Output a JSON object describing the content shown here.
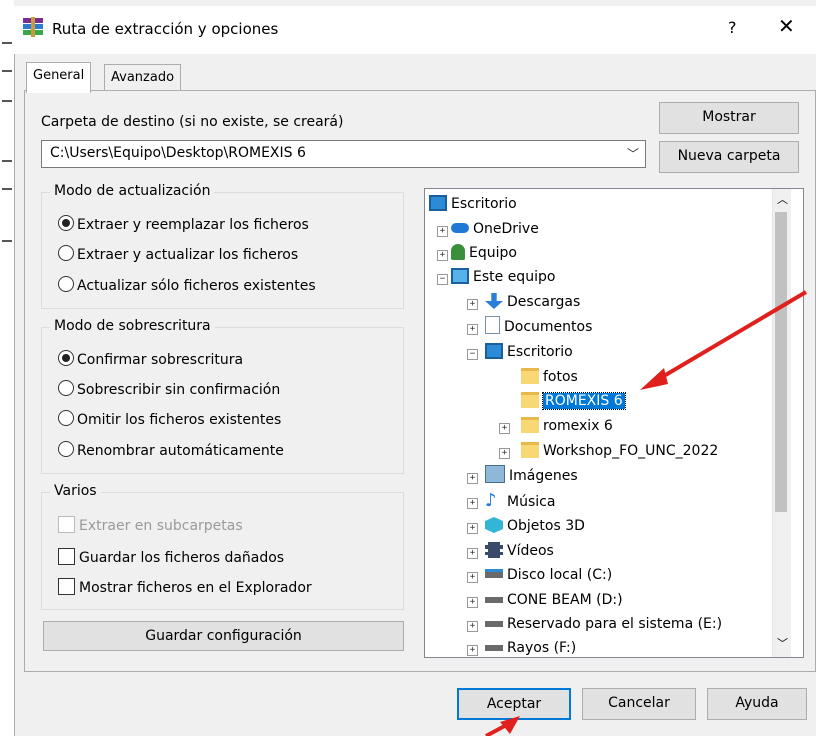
{
  "window": {
    "title": "Ruta de extracción y opciones",
    "help_label": "?",
    "close_label": "✕"
  },
  "tabs": [
    {
      "label": "General"
    },
    {
      "label": "Avanzado"
    }
  ],
  "destination": {
    "label": "Carpeta de destino (si no existe, se creará)",
    "path": "C:\\Users\\Equipo\\Desktop\\ROMEXIS 6",
    "show_button": "Mostrar",
    "new_folder_button": "Nueva carpeta"
  },
  "update_mode": {
    "title": "Modo de actualización",
    "options": [
      "Extraer y reemplazar los ficheros",
      "Extraer y actualizar los ficheros",
      "Actualizar sólo ficheros existentes"
    ],
    "selected": 0
  },
  "overwrite_mode": {
    "title": "Modo de sobrescritura",
    "options": [
      "Confirmar sobrescritura",
      "Sobrescribir sin confirmación",
      "Omitir los ficheros existentes",
      "Renombrar automáticamente"
    ],
    "selected": 0
  },
  "misc": {
    "title": "Varios",
    "options": [
      {
        "label": "Extraer en subcarpetas",
        "checked": false,
        "disabled": true
      },
      {
        "label": "Guardar los ficheros dañados",
        "checked": false,
        "disabled": false
      },
      {
        "label": "Mostrar ficheros en el Explorador",
        "checked": false,
        "disabled": false
      }
    ]
  },
  "save_config_button": "Guardar configuración",
  "tree": {
    "nodes": [
      {
        "label": "Escritorio",
        "icon": "monitor-icon"
      },
      {
        "label": "OneDrive",
        "icon": "cloud-icon"
      },
      {
        "label": "Equipo",
        "icon": "user-icon"
      },
      {
        "label": "Este equipo",
        "icon": "monitor-icon"
      },
      {
        "label": "Descargas",
        "icon": "download-icon"
      },
      {
        "label": "Documentos",
        "icon": "document-icon"
      },
      {
        "label": "Escritorio",
        "icon": "monitor-icon"
      },
      {
        "label": "fotos",
        "icon": "folder-icon"
      },
      {
        "label": "ROMEXIS 6",
        "icon": "folder-icon",
        "selected": true
      },
      {
        "label": "romexix 6",
        "icon": "folder-icon"
      },
      {
        "label": "Workshop_FO_UNC_2022",
        "icon": "folder-icon"
      },
      {
        "label": "Imágenes",
        "icon": "image-icon"
      },
      {
        "label": "Música",
        "icon": "music-icon"
      },
      {
        "label": "Objetos 3D",
        "icon": "cube-icon"
      },
      {
        "label": "Vídeos",
        "icon": "film-icon"
      },
      {
        "label": "Disco local (C:)",
        "icon": "drive-icon"
      },
      {
        "label": "CONE BEAM (D:)",
        "icon": "drive-icon"
      },
      {
        "label": "Reservado para el sistema (E:)",
        "icon": "drive-icon"
      },
      {
        "label": "Rayos (F:)",
        "icon": "drive-icon"
      }
    ]
  },
  "footer": {
    "ok": "Aceptar",
    "cancel": "Cancelar",
    "help": "Ayuda"
  },
  "colors": {
    "selection": "#0078d7",
    "annotation_arrow": "#e0201c",
    "ok_border": "#0078d7"
  }
}
